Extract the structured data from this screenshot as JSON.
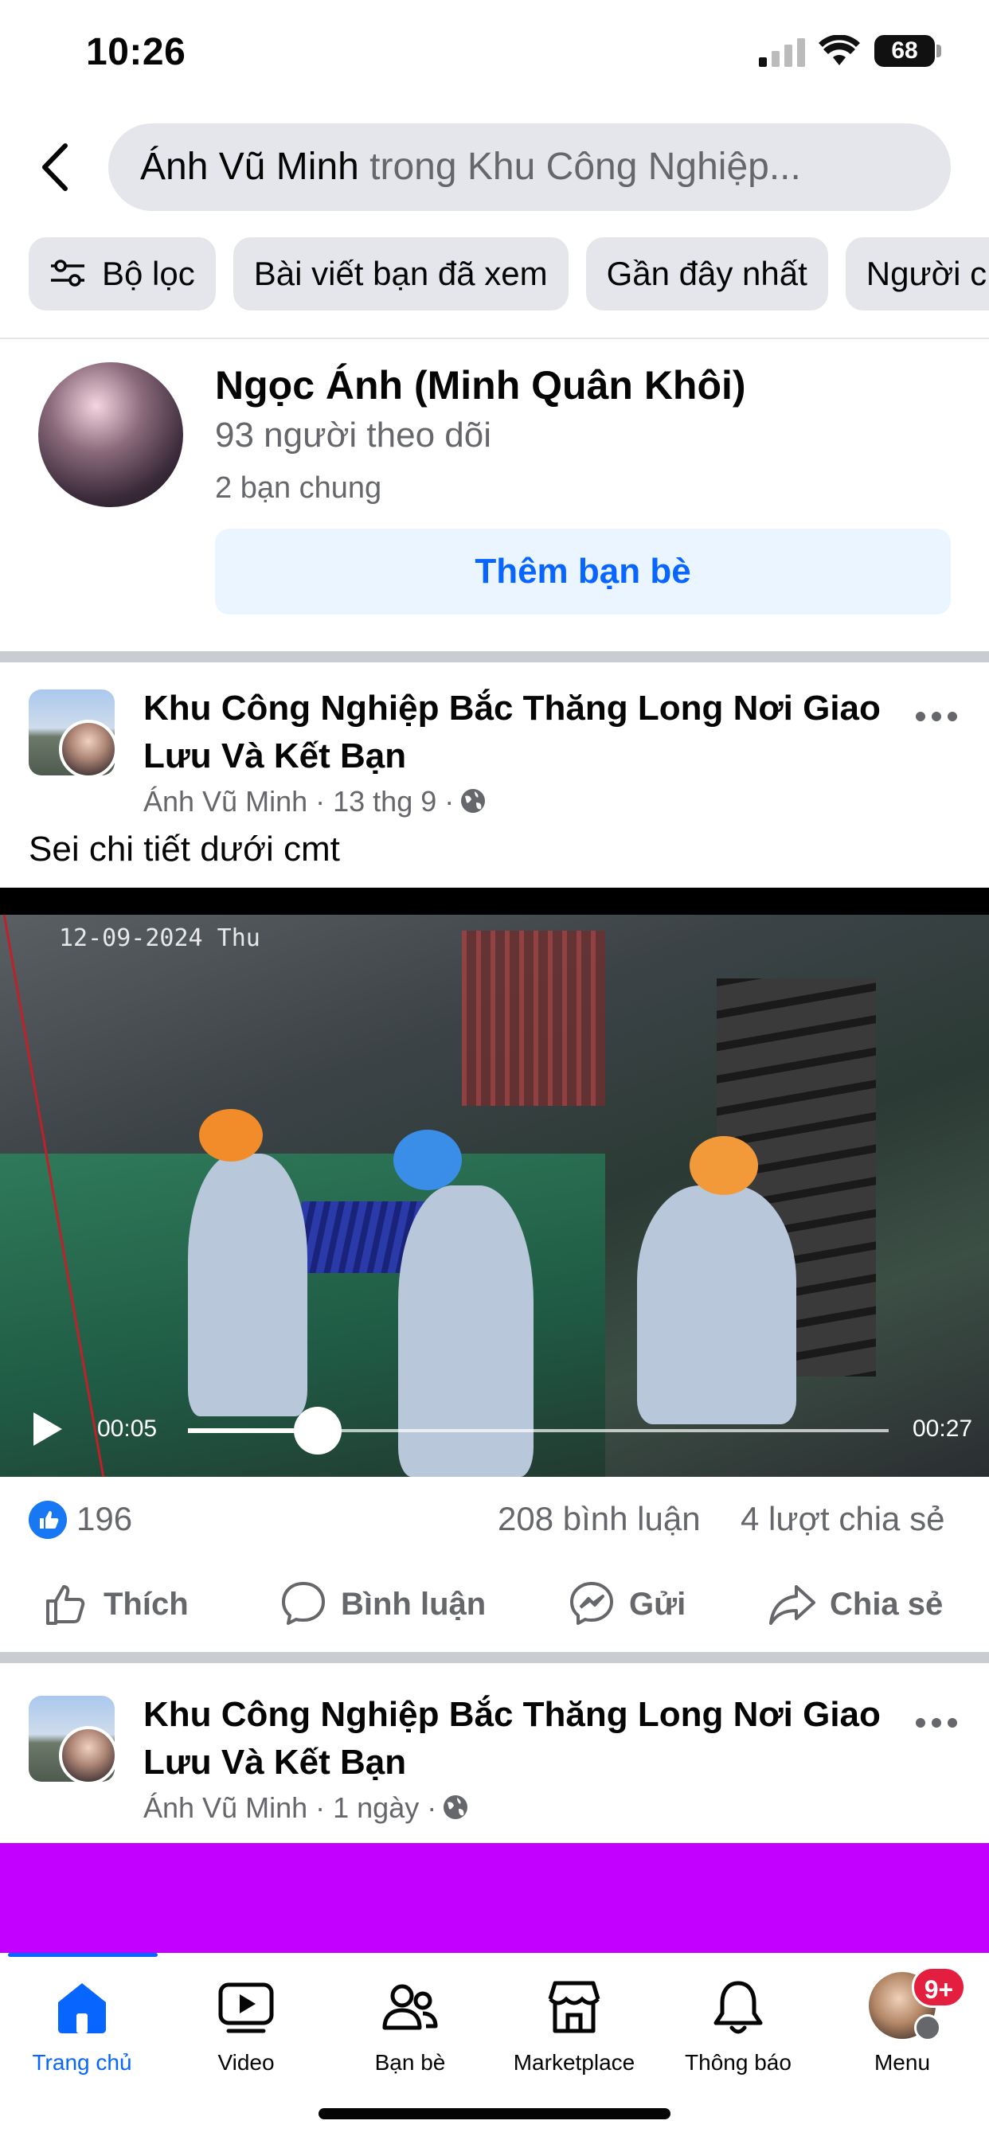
{
  "status_bar": {
    "time": "10:26",
    "battery": "68"
  },
  "search": {
    "query": "Ánh Vũ Minh",
    "scope_text": " trong Khu Công Nghiệp..."
  },
  "filters": {
    "items": [
      "Bộ lọc",
      "Bài viết bạn đã xem",
      "Gần đây nhất",
      "Người c"
    ]
  },
  "person_result": {
    "name": "Ngọc Ánh (Minh Quân Khôi)",
    "followers": "93 người theo dõi",
    "mutual": "2 bạn chung",
    "add_button": "Thêm bạn bè"
  },
  "post1": {
    "group_name": "Khu Công Nghiệp Bắc Thăng Long Nơi Giao Lưu Và Kết Bạn",
    "author": "Ánh Vũ Minh",
    "time": "13 thg 9",
    "text": "Sei chi tiết dưới cmt",
    "video": {
      "overlay_timestamp": "12-09-2024 Thu",
      "current_time": "00:05",
      "duration": "00:27",
      "progress": 0.185
    },
    "likes": "196",
    "comments": "208 bình luận",
    "shares": "4 lượt chia sẻ",
    "actions": {
      "like": "Thích",
      "comment": "Bình luận",
      "send": "Gửi",
      "share": "Chia sẻ"
    }
  },
  "post2": {
    "group_name": "Khu Công Nghiệp Bắc Thăng Long Nơi Giao Lưu Và Kết Bạn",
    "author": "Ánh Vũ Minh",
    "time": "1 ngày"
  },
  "bottom_nav": {
    "items": [
      "Trang chủ",
      "Video",
      "Bạn bè",
      "Marketplace",
      "Thông báo",
      "Menu"
    ],
    "menu_badge": "9+"
  },
  "colors": {
    "accent": "#0866ff",
    "secondary_text": "#65676b",
    "chip_bg": "#e4e6eb",
    "ad_block": "#c300ff"
  }
}
